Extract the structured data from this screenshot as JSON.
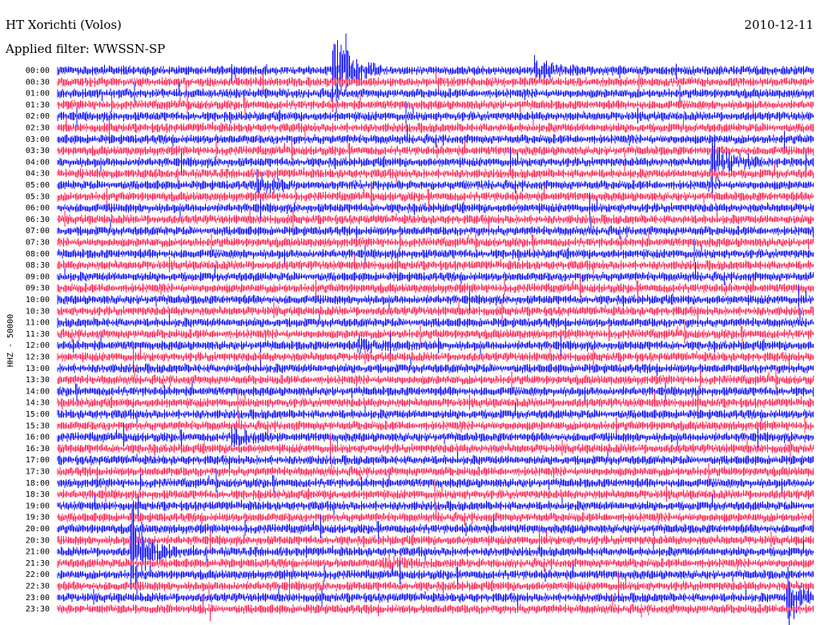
{
  "header": {
    "station": "HT Xorichti (Volos)",
    "filter": "Applied filter: WWSSN-SP",
    "date": "2010-12-11"
  },
  "chart_data": {
    "type": "line",
    "title": "HT Xorichti (Volos)",
    "subtitle": "Applied filter: WWSSN-SP",
    "date": "2010-12-11",
    "ylabel": "HHZ - 50000",
    "row_labels": [
      "00:00",
      "00:30",
      "01:00",
      "01:30",
      "02:00",
      "02:30",
      "03:00",
      "03:30",
      "04:00",
      "04:30",
      "05:00",
      "05:30",
      "06:00",
      "06:30",
      "07:00",
      "07:30",
      "08:00",
      "08:30",
      "09:00",
      "09:30",
      "10:00",
      "10:30",
      "11:00",
      "11:30",
      "12:00",
      "12:30",
      "13:00",
      "13:30",
      "14:00",
      "14:30",
      "15:00",
      "15:30",
      "16:00",
      "16:30",
      "17:00",
      "17:30",
      "18:00",
      "18:30",
      "19:00",
      "19:30",
      "20:00",
      "20:30",
      "21:00",
      "21:30",
      "22:00",
      "22:30",
      "23:00",
      "23:30"
    ],
    "series_colors": [
      "#0000ff",
      "#ff1a4d"
    ],
    "x_minutes_per_row": 30,
    "events": [
      {
        "row": 0,
        "minute": 11,
        "amplitude": 12
      },
      {
        "row": 0,
        "minute": 19,
        "amplitude": 3
      },
      {
        "row": 8,
        "minute": 26,
        "amplitude": 6
      },
      {
        "row": 10,
        "minute": 8,
        "amplitude": 3
      },
      {
        "row": 24,
        "minute": 12,
        "amplitude": 1.5
      },
      {
        "row": 32,
        "minute": 7,
        "amplitude": 2
      },
      {
        "row": 42,
        "minute": 3,
        "amplitude": 10
      },
      {
        "row": 43,
        "minute": 13,
        "amplitude": 1.5
      },
      {
        "row": 46,
        "minute": 29,
        "amplitude": 6
      }
    ],
    "grid": false,
    "legend": "none"
  }
}
